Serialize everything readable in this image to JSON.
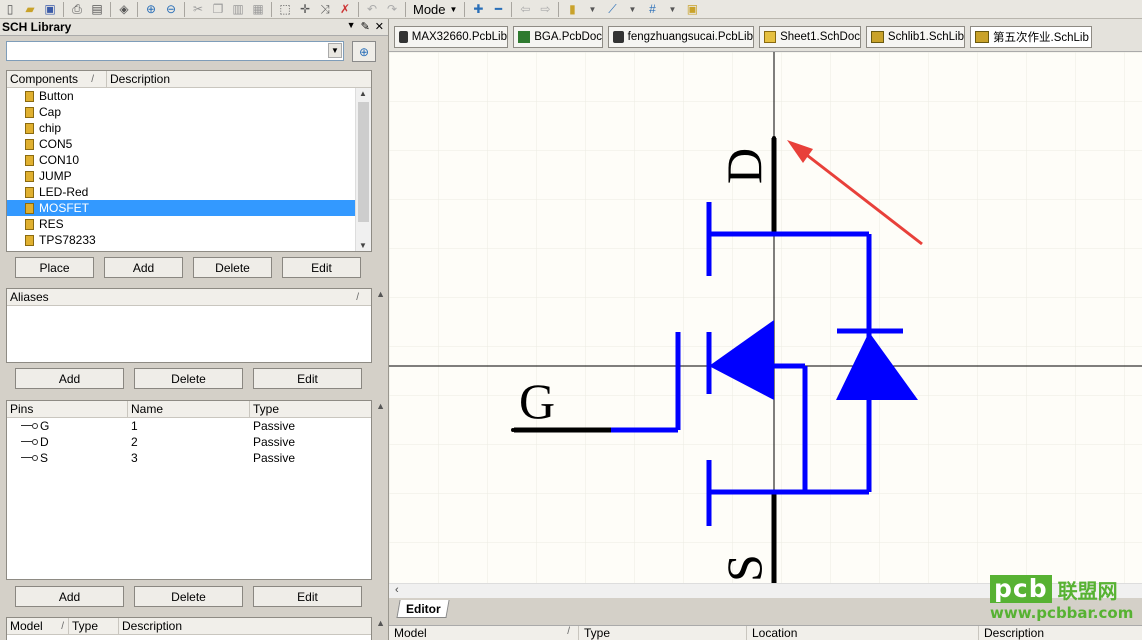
{
  "toolbar": {
    "mode_label": "Mode",
    "icons": [
      "new-icon",
      "open-icon",
      "save-icon",
      "print-icon",
      "print-preview-icon",
      "layers-icon",
      "zoom-in-icon",
      "zoom-out-icon",
      "cut-icon",
      "copy-icon",
      "paste-icon",
      "paste-array-icon",
      "select-icon",
      "move-icon",
      "cross-select-icon",
      "deselect-icon",
      "undo-icon",
      "redo-icon",
      "add-icon",
      "remove-icon",
      "back-icon",
      "forward-icon",
      "place-part-icon",
      "graph-icon",
      "grid-icon",
      "component-icon"
    ]
  },
  "panel": {
    "title": "SCH Library",
    "search_value": ""
  },
  "components": {
    "header_name": "Components",
    "header_desc": "Description",
    "items": [
      "Button",
      "Cap",
      "chip",
      "CON5",
      "CON10",
      "JUMP",
      "LED-Red",
      "MOSFET",
      "RES",
      "TPS78233"
    ],
    "selected": "MOSFET",
    "buttons": [
      "Place",
      "Add",
      "Delete",
      "Edit"
    ]
  },
  "aliases": {
    "header": "Aliases",
    "buttons": [
      "Add",
      "Delete",
      "Edit"
    ]
  },
  "pins": {
    "headers": [
      "Pins",
      "Name",
      "Type"
    ],
    "rows": [
      {
        "pin": "G",
        "name": "1",
        "type": "Passive"
      },
      {
        "pin": "D",
        "name": "2",
        "type": "Passive"
      },
      {
        "pin": "S",
        "name": "3",
        "type": "Passive"
      }
    ],
    "buttons": [
      "Add",
      "Delete",
      "Edit"
    ]
  },
  "model": {
    "headers": [
      "Model",
      "Type",
      "Description"
    ]
  },
  "doc_tabs": [
    {
      "label": "MAX32660.PcbLib",
      "icon": "pcblib-icon"
    },
    {
      "label": "BGA.PcbDoc",
      "icon": "pcbdoc-icon"
    },
    {
      "label": "fengzhuangsucai.PcbLib",
      "icon": "pcblib-icon"
    },
    {
      "label": "Sheet1.SchDoc",
      "icon": "schdoc-icon"
    },
    {
      "label": "Schlib1.SchLib",
      "icon": "schlib-icon"
    },
    {
      "label": "第五次作业.SchLib",
      "icon": "schlib-icon"
    }
  ],
  "schematic": {
    "pin_labels": {
      "gate": "G",
      "drain": "D",
      "source": "S"
    },
    "colors": {
      "body": "#0000ff",
      "pin": "#000000",
      "axis": "#000000",
      "arrow": "#e8403a",
      "grid": "#eceae0"
    }
  },
  "editor_tab": "Editor",
  "bottom_headers": [
    "Model",
    "Type",
    "Location",
    "Description"
  ],
  "watermark": {
    "logo": "pcb",
    "cn": "联盟网",
    "url": "www.pcbbar.com"
  }
}
